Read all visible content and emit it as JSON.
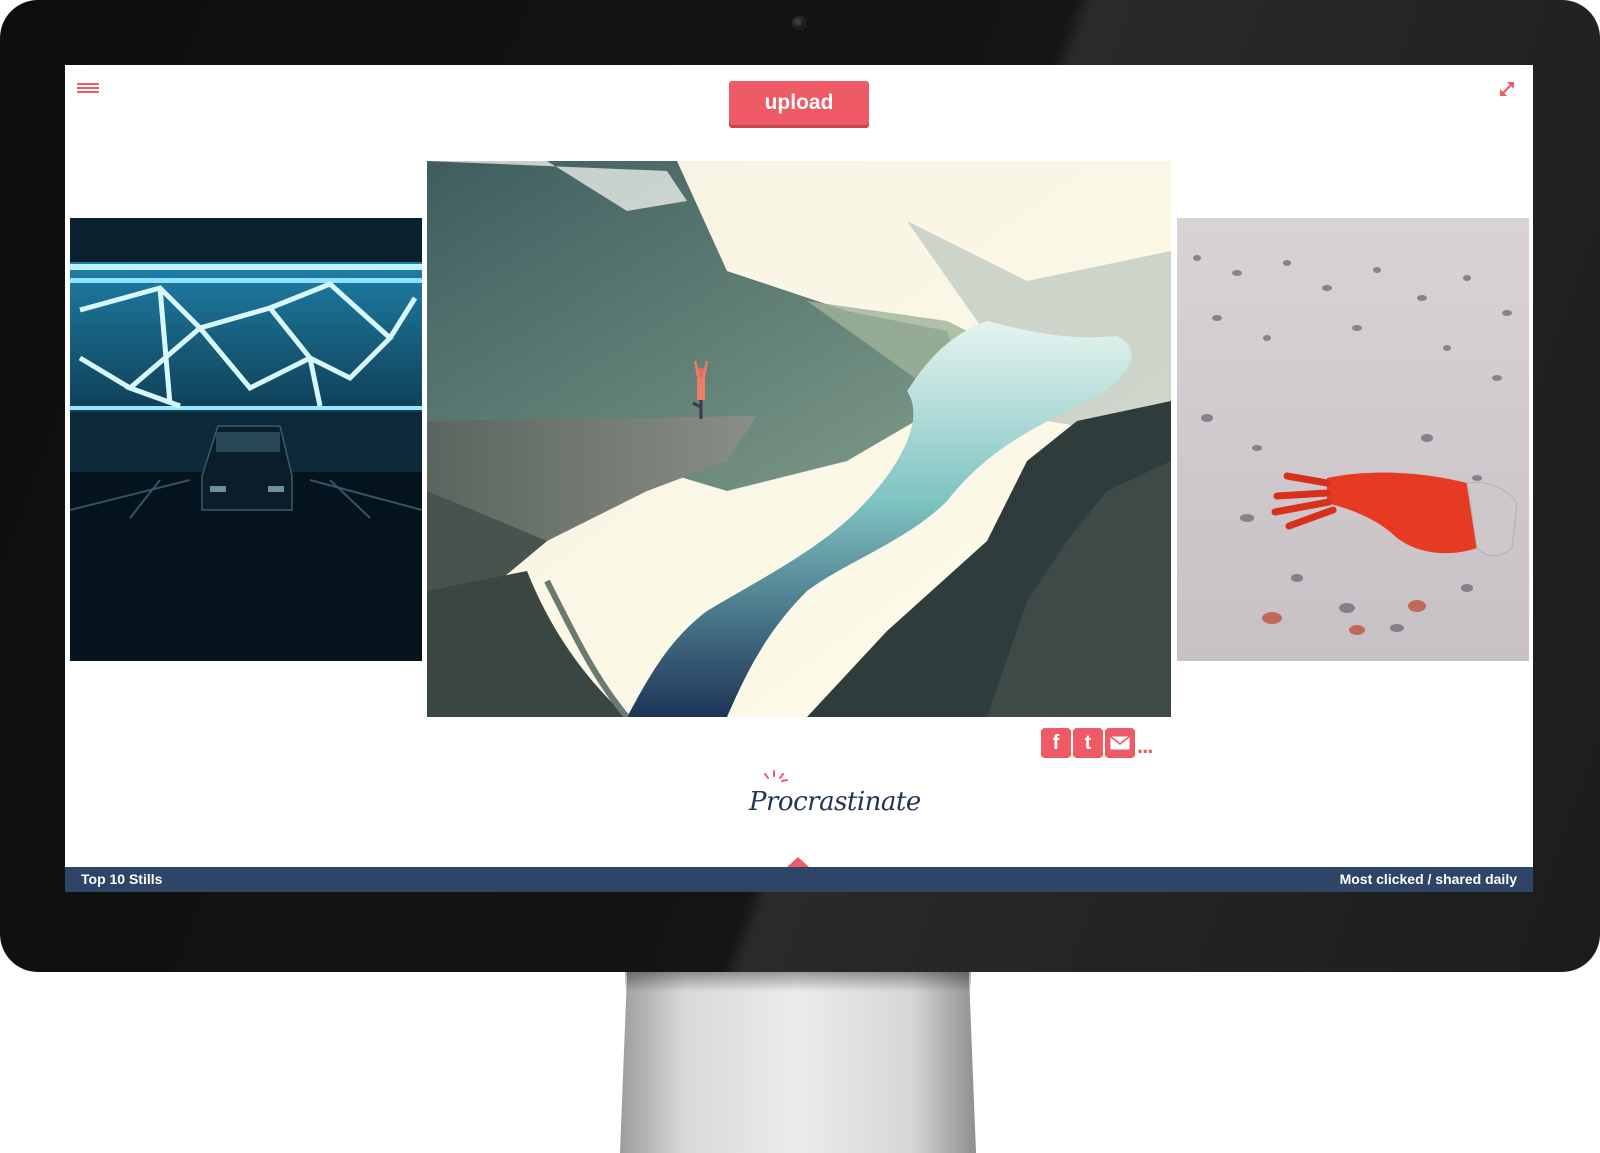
{
  "header": {
    "upload_label": "upload",
    "menu_icon": "hamburger-menu-icon",
    "expand_icon": "expand-arrows-icon"
  },
  "gallery": {
    "photos": [
      {
        "subject": "neon-parking-garage"
      },
      {
        "subject": "fjord-cliff-yoga"
      },
      {
        "subject": "red-glove-sand"
      }
    ]
  },
  "share": {
    "facebook_glyph": "f",
    "twitter_glyph": "t",
    "mail_icon": "envelope-icon",
    "more_label": "..."
  },
  "logo": {
    "text": "Procrastinate"
  },
  "footer": {
    "left_label": "Top 10 Stills",
    "right_label": "Most clicked / shared daily"
  },
  "colors": {
    "accent": "#ee5a66",
    "bar": "#2e4567",
    "logo": "#243553"
  }
}
